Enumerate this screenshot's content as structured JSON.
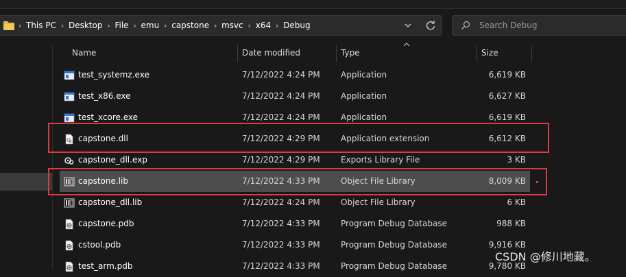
{
  "breadcrumbs": [
    "This PC",
    "Desktop",
    "File",
    "emu",
    "capstone",
    "msvc",
    "x64",
    "Debug"
  ],
  "search": {
    "placeholder": "Search Debug"
  },
  "columns": {
    "name": "Name",
    "date": "Date modified",
    "type": "Type",
    "size": "Size"
  },
  "files": [
    {
      "name": "test_systemz.exe",
      "date": "7/12/2022 4:24 PM",
      "type": "Application",
      "size": "6,619 KB",
      "icon": "exe-icon"
    },
    {
      "name": "test_x86.exe",
      "date": "7/12/2022 4:24 PM",
      "type": "Application",
      "size": "6,627 KB",
      "icon": "exe-icon"
    },
    {
      "name": "test_xcore.exe",
      "date": "7/12/2022 4:24 PM",
      "type": "Application",
      "size": "6,619 KB",
      "icon": "exe-icon"
    },
    {
      "name": "capstone.dll",
      "date": "7/12/2022 4:29 PM",
      "type": "Application extension",
      "size": "6,612 KB",
      "icon": "dll-icon"
    },
    {
      "name": "capstone_dll.exp",
      "date": "7/12/2022 4:29 PM",
      "type": "Exports Library File",
      "size": "3 KB",
      "icon": "exp-icon"
    },
    {
      "name": "capstone.lib",
      "date": "7/12/2022 4:33 PM",
      "type": "Object File Library",
      "size": "8,009 KB",
      "icon": "lib-icon",
      "selected": true
    },
    {
      "name": "capstone_dll.lib",
      "date": "7/12/2022 4:24 PM",
      "type": "Object File Library",
      "size": "6 KB",
      "icon": "lib-icon"
    },
    {
      "name": "capstone.pdb",
      "date": "7/12/2022 4:33 PM",
      "type": "Program Debug Database",
      "size": "988 KB",
      "icon": "pdb-icon"
    },
    {
      "name": "cstool.pdb",
      "date": "7/12/2022 4:33 PM",
      "type": "Program Debug Database",
      "size": "9,916 KB",
      "icon": "pdb-icon"
    },
    {
      "name": "test_arm.pdb",
      "date": "7/12/2022 4:33 PM",
      "type": "Program Debug Database",
      "size": "9,780 KB",
      "icon": "pdb-icon"
    }
  ],
  "watermark": "CSDN @修川地藏。",
  "colors": {
    "highlight": "#e0393e",
    "selected_row": "#4d4d4d",
    "background": "#191919"
  }
}
